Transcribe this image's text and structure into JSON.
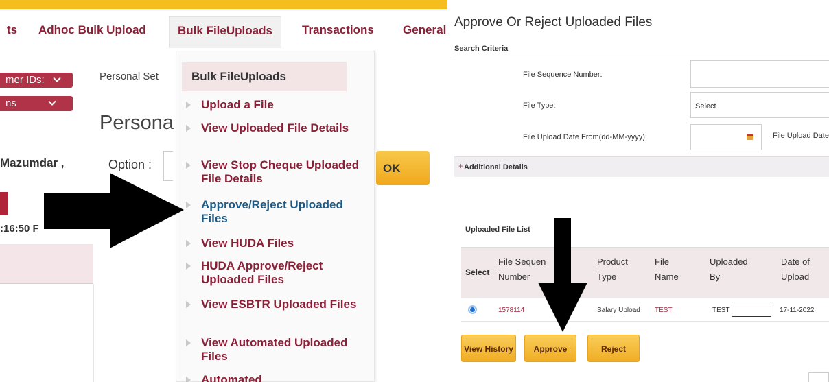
{
  "left_panel": {
    "nav": {
      "items": [
        "ts",
        "Adhoc Bulk Upload",
        "Bulk FileUploads",
        "Transactions",
        "General"
      ],
      "active": "Bulk FileUploads"
    },
    "dropdowns": {
      "customer_ids": "mer IDs:",
      "options": "ns"
    },
    "personal_settings_link": "Personal Set",
    "page_heading": "Persona",
    "user_name": "Mazumdar ,",
    "option_label": "Option :",
    "ok_button": "OK",
    "time_text": ":16:50 F",
    "menu": {
      "title": "Bulk FileUploads",
      "items": [
        "Upload a File",
        "View Uploaded File Details",
        "View Stop Cheque Uploaded File Details",
        "Approve/Reject Uploaded Files",
        "View HUDA Files",
        "HUDA Approve/Reject Uploaded Files",
        "View ESBTR Uploaded Files",
        "View Automated Uploaded Files",
        "Automated"
      ],
      "highlighted": "Approve/Reject Uploaded Files"
    }
  },
  "right_panel": {
    "title": "Approve Or Reject Uploaded Files",
    "search_criteria_label": "Search Criteria",
    "fields": {
      "file_sequence_number": {
        "label": "File Sequence Number:",
        "value": ""
      },
      "file_type": {
        "label": "File Type:",
        "value": "Select"
      },
      "upload_date_from": {
        "label": "File Upload Date From(dd-MM-yyyy):",
        "value": ""
      },
      "upload_date_to_label": "File Upload Date"
    },
    "additional_details": "Additional Details",
    "uploaded_file_list": {
      "title": "Uploaded File List",
      "columns": [
        "Select",
        "File Sequen Number",
        "Product Type",
        "File Name",
        "Uploaded By",
        "Date of Upload"
      ],
      "rows": [
        {
          "selected": true,
          "file_sequence_number": "1578114",
          "product_type": "Salary Upload",
          "file_name": "TEST",
          "uploaded_by": "TEST",
          "date_of_upload": "17-11-2022"
        }
      ]
    },
    "buttons": {
      "view_history": "View History",
      "approve": "Approve",
      "reject": "Reject"
    }
  },
  "colors": {
    "brand_yellow": "#f5be1e",
    "maroon_text": "#8b1f36",
    "highlight_blue": "#1c5a85",
    "button_gold": "#f0ad24",
    "annotation_arrow": "#000000"
  }
}
